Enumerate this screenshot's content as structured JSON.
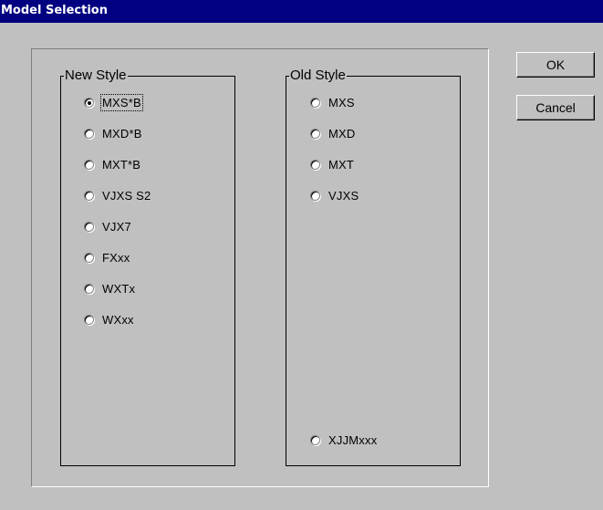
{
  "window": {
    "title": "Model Selection"
  },
  "new_style": {
    "label": "New Style",
    "options": [
      "MXS*B",
      "MXD*B",
      "MXT*B",
      "VJXS S2",
      "VJX7",
      "FXxx",
      "WXTx",
      "WXxx"
    ],
    "selected": "MXS*B"
  },
  "old_style": {
    "label": "Old Style",
    "options": [
      "MXS",
      "MXD",
      "MXT",
      "VJXS"
    ],
    "extra_option": "XJJMxxx"
  },
  "buttons": {
    "ok": "OK",
    "cancel": "Cancel"
  },
  "colors": {
    "titlebar": "#000080",
    "face": "#c0c0c0"
  }
}
